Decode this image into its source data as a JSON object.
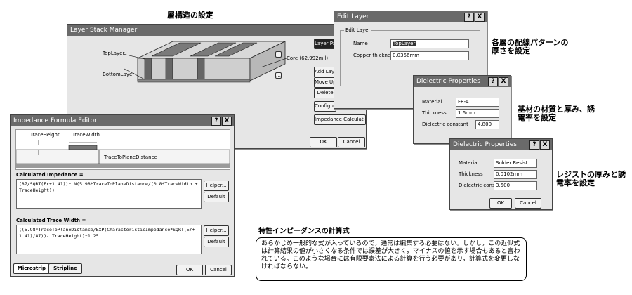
{
  "captions": {
    "layer_structure": "層構造の設定",
    "wiring_thickness": "各層の配線パターンの厚さを設定",
    "substrate": "基材の材質と厚み、誘電率を設定",
    "resist": "レジストの厚みと誘電率を設定",
    "impedance_formula": "特性インピーダンスの計算式",
    "note": "あらかじめ一般的な式が入っているので，通常は編集する必要はない。しかし，この近似式は計算結果の値が小さくなる条件では誤差が大きく，マイナスの値を示す場合もあると言われている。このような場合には有限要素法による計算を行う必要があり，計算式を変更しなければならない。"
  },
  "stack_manager": {
    "title": "Layer Stack Manager",
    "top_layer": "TopLayer",
    "bottom_layer": "BottomLayer",
    "core": "Core (62.992mil)",
    "layer_pairs": "Layer Pairs",
    "add_layer": "Add Layer",
    "move_up": "Move Up",
    "delete": "Delete",
    "configure": "Configure...",
    "impedance_calc": "Impedance Calculation...",
    "ok": "OK",
    "cancel": "Cancel"
  },
  "edit_layer": {
    "title": "Edit Layer",
    "group": "Edit Layer",
    "name_label": "Name",
    "name_value": "TopLayer",
    "copper_label": "Copper thickness",
    "copper_value": "0.0356mm"
  },
  "dielectric1": {
    "title": "Dielectric Properties",
    "material_label": "Material",
    "material_value": "FR-4",
    "thickness_label": "Thickness",
    "thickness_value": "1.6mm",
    "constant_label": "Dielectric constant",
    "constant_value": "4.800"
  },
  "dielectric2": {
    "title": "Dielectric Properties",
    "material_label": "Material",
    "material_value": "Solder Resist",
    "thickness_label": "Thickness",
    "thickness_value": "0.0102mm",
    "constant_label": "Dielectric constant",
    "constant_value": "3.500",
    "ok": "OK",
    "cancel": "Cancel"
  },
  "impedance_editor": {
    "title": "Impedance Formula Editor",
    "trace_height": "TraceHeight",
    "trace_width": "TraceWidth",
    "trace_to_plane": "TraceToPlaneDistance",
    "calc_impedance_label": "Calculated Impedance =",
    "calc_impedance_formula": "(87/SQRT(Er+1.41))*LN(5.98*TraceToPlaneDistance/(0.8*TraceWidth + TraceHeight))",
    "calc_width_label": "Calculated Trace Width =",
    "calc_width_formula": "((5.98*TraceToPlaneDistance/EXP(CharacteristicImpedance*SQRT(Er+1.41)/87))- TraceHeight)*1.25",
    "helper": "Helper...",
    "default": "Default",
    "tab_microstrip": "Microstrip",
    "tab_stripline": "Stripline",
    "ok": "OK",
    "cancel": "Cancel"
  },
  "title_buttons": {
    "help": "?",
    "close": "X"
  }
}
